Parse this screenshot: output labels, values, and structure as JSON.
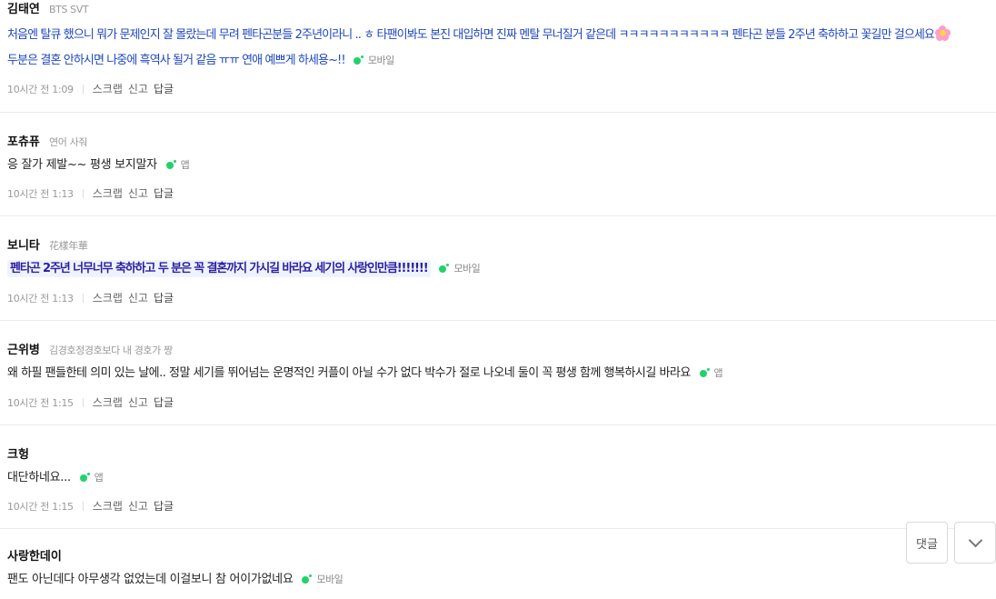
{
  "actions": {
    "scrap": "스크랩",
    "report": "신고",
    "reply": "답글"
  },
  "floating": {
    "comment_label": "댓글"
  },
  "comments": [
    {
      "nick": "김태연",
      "sub": "BTS SVT",
      "lines": [
        "처음엔 탈큐 했으니 뭐가 문제인지 잘 몰랐는데 무려 펜타곤분들 2주년이라니 .. ㅎ 타팬이봐도 본진 대입하면 진짜 멘탈 무너질거 같은데 ㅋㅋㅋㅋㅋㅋㅋㅋㅋㅋㅋ 펜타곤 분들 2주년 축하하고 꽃길만 걸으세요",
        "두분은 결혼 안하시면 나중에 흑역사 될거 같음 ㅠㅠ 연애 예쁘게 하세용~!!"
      ],
      "emoji": "flower-emoji",
      "device": "모바일",
      "time": "10시간 전 1:09"
    },
    {
      "nick": "포츄퓨",
      "sub": "연어 사줘",
      "lines": [
        "응 잘가 제발~~ 평생 보지말자"
      ],
      "device": "앱",
      "time": "10시간 전 1:13"
    },
    {
      "nick": "보니타",
      "sub": "花樣年華",
      "lines": [
        "펜타곤 2주년 너무너무 축하하고 두 분은 꼭 결혼까지 가시길 바라요 세기의 사랑인만큼!!!!!!!"
      ],
      "device": "모바일",
      "time": "10시간 전 1:13"
    },
    {
      "nick": "근위병",
      "sub": "김경호정경호보다 내 경호가 짱",
      "lines": [
        "왜 하필 팬들한테 의미 있는 날에.. 정말 세기를 뛰어넘는 운명적인 커플이 아닐 수가 없다 박수가 절로 나오네 둘이 꼭 평생 함께 행복하시길 바라요"
      ],
      "device": "앱",
      "time": "10시간 전 1:15"
    },
    {
      "nick": "크헝",
      "sub": "",
      "lines": [
        "대단하네요..."
      ],
      "device": "앱",
      "time": "10시간 전 1:15"
    },
    {
      "nick": "사랑한데이",
      "sub": "",
      "lines": [
        "팬도 아닌데다 아무생각 없었는데 이걸보니 참 어이가없네요"
      ],
      "device": "모바일",
      "time": ""
    }
  ]
}
